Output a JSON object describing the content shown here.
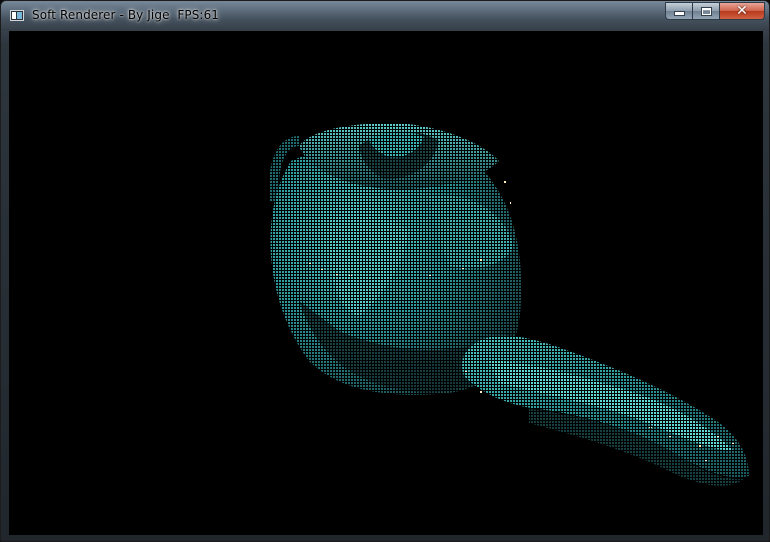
{
  "window": {
    "title": "Soft Renderer - By Jige  FPS:61",
    "controls": {
      "minimize": "minimize",
      "maximize": "maximize",
      "close": "✕"
    }
  },
  "icons": {
    "app": "app-window-icon",
    "minimize": "minimize-icon",
    "maximize": "maximize-icon",
    "close": "close-icon"
  },
  "viewport": {
    "background": "#000000",
    "model": "teapot",
    "shade_dark": "#1f4f52",
    "shade_mid": "#2f9ea0",
    "shade_light": "#5fdad6",
    "highlight": "#fff2c0"
  }
}
